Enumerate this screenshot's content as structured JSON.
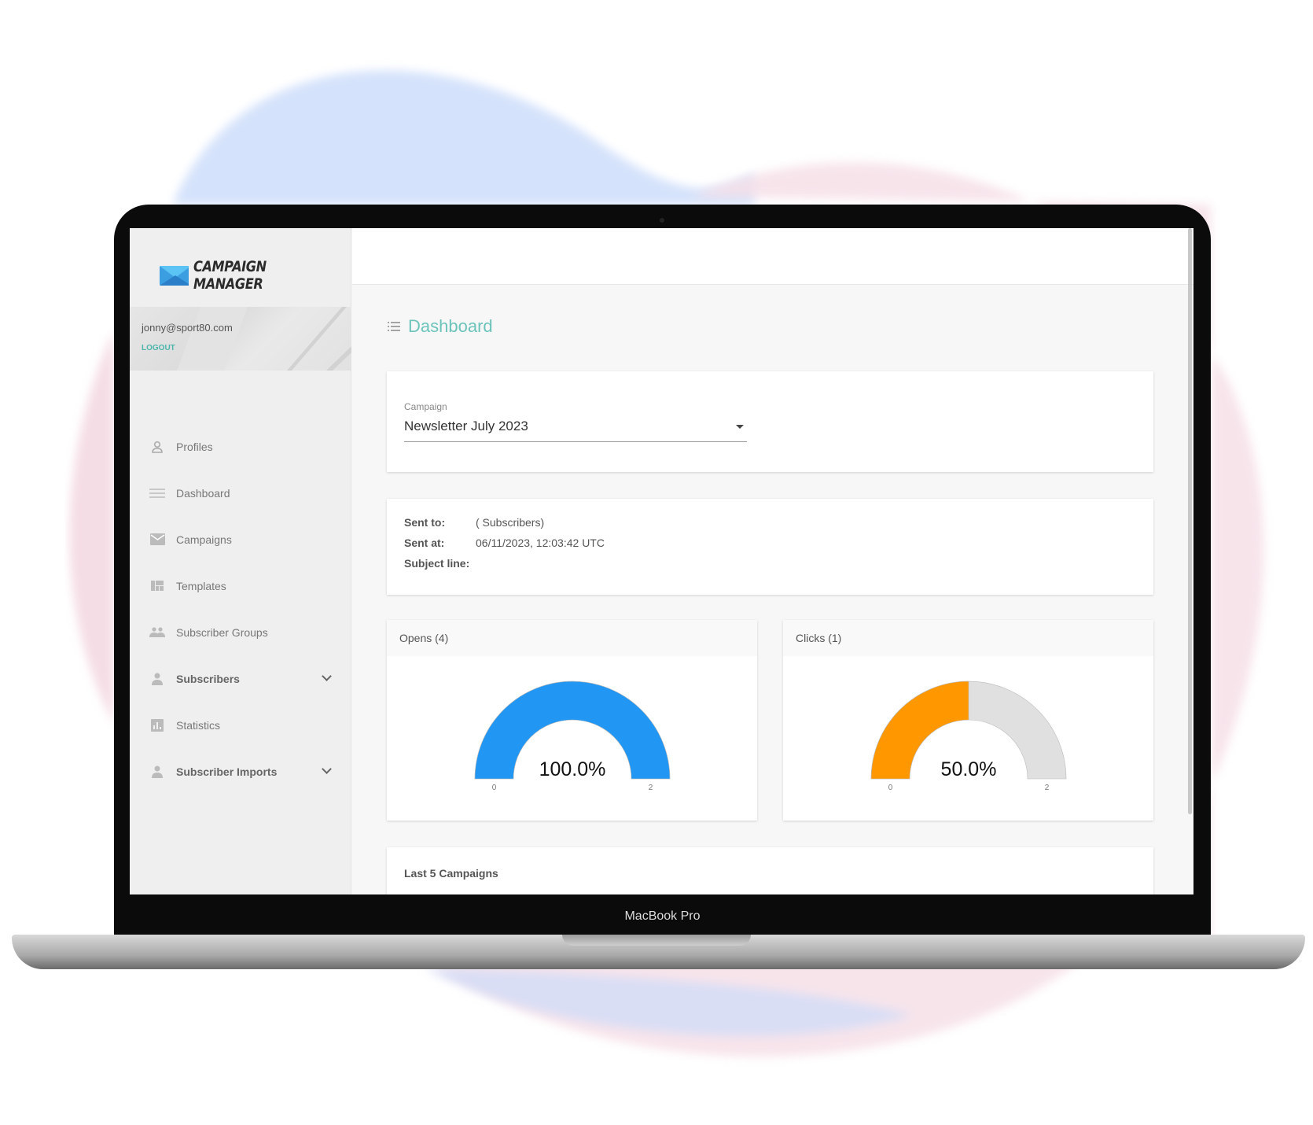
{
  "app": {
    "name": "CAMPAIGN MANAGER",
    "brand_colors": {
      "accent": "#4db6ac",
      "opens": "#2196f3",
      "clicks": "#ff9800",
      "track": "#e0e0e0"
    }
  },
  "user": {
    "email": "jonny@sport80.com",
    "logout": "LOGOUT"
  },
  "sidebar": {
    "items": [
      {
        "label": "Profiles",
        "icon": "person-outline-icon"
      },
      {
        "label": "Dashboard",
        "icon": "menu-lines-icon"
      },
      {
        "label": "Campaigns",
        "icon": "envelope-icon"
      },
      {
        "label": "Templates",
        "icon": "template-grid-icon"
      },
      {
        "label": "Subscriber Groups",
        "icon": "people-icon"
      },
      {
        "label": "Subscribers",
        "icon": "person-icon",
        "expandable": true
      },
      {
        "label": "Statistics",
        "icon": "bar-chart-icon"
      },
      {
        "label": "Subscriber Imports",
        "icon": "person-icon",
        "expandable": true
      }
    ]
  },
  "page": {
    "title": "Dashboard"
  },
  "campaign_select": {
    "label": "Campaign",
    "value": "Newsletter July 2023"
  },
  "details": {
    "sent_to_label": "Sent to:",
    "sent_to": "( Subscribers)",
    "sent_at_label": "Sent at:",
    "sent_at": "06/11/2023, 12:03:42 UTC",
    "subject_label": "Subject line:",
    "subject": ""
  },
  "gauges": [
    {
      "title": "Opens (4)",
      "percent_label": "100.0%",
      "value": 2,
      "min": 0,
      "max": 2,
      "min_label": "0",
      "max_label": "2",
      "color": "#2196f3"
    },
    {
      "title": "Clicks (1)",
      "percent_label": "50.0%",
      "value": 1,
      "min": 0,
      "max": 2,
      "min_label": "0",
      "max_label": "2",
      "color": "#ff9800"
    }
  ],
  "last_campaigns": {
    "title": "Last 5 Campaigns"
  },
  "device": {
    "label": "MacBook Pro"
  }
}
